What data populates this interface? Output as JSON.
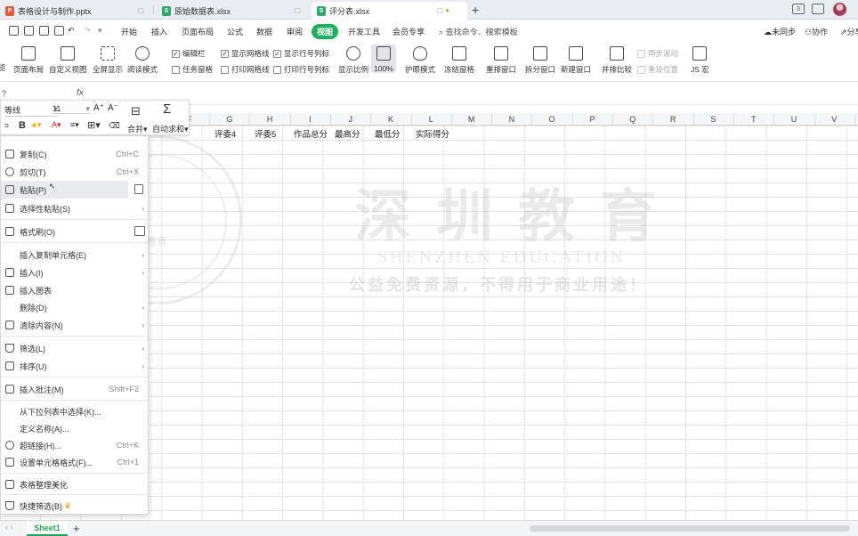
{
  "tabs": [
    {
      "label": "表格设计与制作.pptx",
      "type": "ppt"
    },
    {
      "label": "原始数据表.xlsx",
      "type": "xls"
    },
    {
      "label": "评分表.xlsx",
      "type": "xls"
    }
  ],
  "tab_new": "+",
  "window_badge": "3",
  "menu": [
    "开始",
    "插入",
    "页面布局",
    "公式",
    "数据",
    "审阅",
    "视图",
    "开发工具",
    "会员专享"
  ],
  "menu_active": "视图",
  "search_placeholder": "查找命令、搜索模板",
  "right_actions": [
    "未同步",
    "协作",
    "分享"
  ],
  "ribbon": {
    "buttons": [
      "页面布局",
      "自定义视图",
      "全屏显示",
      "阅读模式",
      "显示比例",
      "100%",
      "护眼模式",
      "冻结窗格",
      "重排窗口",
      "拆分窗口",
      "新建窗口",
      "并排比较",
      "JS 宏"
    ],
    "cut_label": "览",
    "checks": [
      {
        "label": "编辑栏",
        "checked": true
      },
      {
        "label": "显示网格线",
        "checked": true
      },
      {
        "label": "显示行号列标",
        "checked": true
      },
      {
        "label": "任务窗格",
        "checked": false
      },
      {
        "label": "打印网格线",
        "checked": false
      },
      {
        "label": "打印行号列标",
        "checked": false
      },
      {
        "label": "同步滚动",
        "checked": false
      },
      {
        "label": "重设位置",
        "checked": false
      }
    ]
  },
  "formula_bar": {
    "name_box": "?",
    "fx": "fx"
  },
  "mini_toolbar": {
    "font": "等线",
    "size": "11",
    "merge": "合并",
    "autosum": "自动求和"
  },
  "columns": [
    "F",
    "G",
    "H",
    "I",
    "J",
    "K",
    "L",
    "M",
    "N",
    "O",
    "P",
    "Q",
    "R",
    "S",
    "T",
    "U",
    "V"
  ],
  "header_row": [
    "3",
    "评委4",
    "评委5",
    "作品总分",
    "最高分",
    "最低分",
    "实际得分"
  ],
  "context_menu": [
    {
      "label": "复制(C)",
      "shortcut": "Ctrl+C",
      "icon": "copy-icon"
    },
    {
      "label": "剪切(T)",
      "shortcut": "Ctrl+X",
      "icon": "scissors-icon"
    },
    {
      "label": "粘贴(P)",
      "shortcut": "",
      "icon": "paste-icon"
    },
    {
      "label": "选择性粘贴(S)",
      "shortcut": "",
      "icon": "paste-special-icon"
    },
    {
      "label": "格式刷(O)",
      "shortcut": "",
      "icon": "format-painter-icon"
    },
    {
      "label": "插入复制单元格(E)",
      "shortcut": "",
      "icon": ""
    },
    {
      "label": "插入(I)",
      "shortcut": "",
      "icon": "insert-icon"
    },
    {
      "label": "插入图表",
      "shortcut": "",
      "icon": "chart-icon"
    },
    {
      "label": "删除(D)",
      "shortcut": "",
      "icon": ""
    },
    {
      "label": "清除内容(N)",
      "shortcut": "",
      "icon": "eraser-icon"
    },
    {
      "label": "筛选(L)",
      "shortcut": "",
      "icon": "filter-icon"
    },
    {
      "label": "排序(U)",
      "shortcut": "",
      "icon": "sort-icon"
    },
    {
      "label": "插入批注(M)",
      "shortcut": "Shift+F2",
      "icon": "comment-icon"
    },
    {
      "label": "从下拉列表中选择(K)...",
      "shortcut": "",
      "icon": ""
    },
    {
      "label": "定义名称(A)...",
      "shortcut": "",
      "icon": ""
    },
    {
      "label": "超链接(H)...",
      "shortcut": "Ctrl+K",
      "icon": "link-icon"
    },
    {
      "label": "设置单元格格式(F)...",
      "shortcut": "Ctrl+1",
      "icon": "format-cells-icon"
    },
    {
      "label": "表格整理美化",
      "shortcut": "",
      "icon": "table-beautify-icon"
    },
    {
      "label": "快捷筛选(B)",
      "shortcut": "",
      "icon": "quick-filter-icon"
    }
  ],
  "watermark": {
    "title": "深圳教育",
    "english": "SHENZHEN EDUCATION",
    "slogan": "公益免费资源，不得用于商业用途！",
    "seal_text": "圳教育"
  },
  "sheet_tab": "Sheet1",
  "colors": {
    "accent": "#1fb05d",
    "tab_bar": "#e9ecf1"
  }
}
